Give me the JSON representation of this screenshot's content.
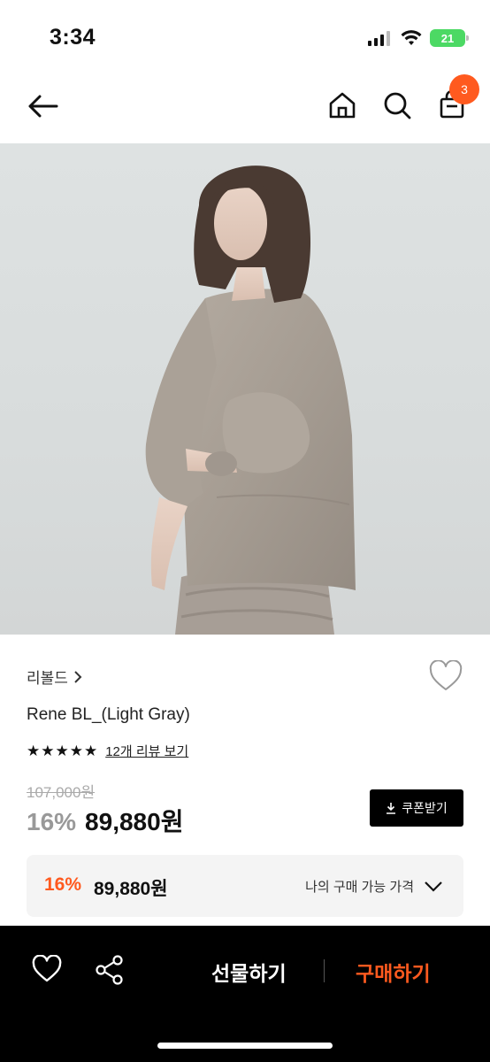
{
  "status_bar": {
    "time": "3:34",
    "battery": "21"
  },
  "nav": {
    "cart_count": "3"
  },
  "product": {
    "brand": "리볼드",
    "name": "Rene BL_(Light Gray)",
    "stars": "★★★★★",
    "review_link": "12개 리뷰 보기",
    "original_price": "107,000원",
    "discount": "16%",
    "sale_price": "89,880원",
    "coupon_label": "쿠폰받기"
  },
  "my_price": {
    "discount": "16%",
    "amount": "89,880원",
    "label": "나의 구매 가능 가격"
  },
  "bottom_bar": {
    "gift_label": "선물하기",
    "buy_label": "구매하기"
  },
  "colors": {
    "accent": "#ff5a1f",
    "dark": "#000000",
    "panel": "#f4f4f4"
  }
}
